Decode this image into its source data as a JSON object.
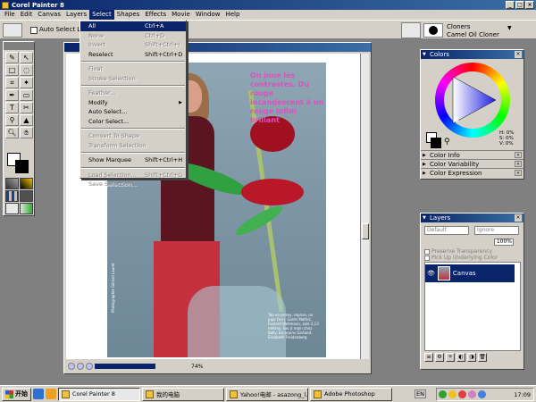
{
  "app": {
    "title": "Corel Painter 8"
  },
  "menubar": [
    "File",
    "Edit",
    "Canvas",
    "Layers",
    "Select",
    "Shapes",
    "Effects",
    "Movie",
    "Window",
    "Help"
  ],
  "active_menu": "Select",
  "propbar": {
    "auto_select_label": "Auto Select Layer",
    "brush_category": "Cloners",
    "brush_variant": "Camel Oil Cloner"
  },
  "select_menu": [
    {
      "label": "All",
      "shortcut": "Ctrl+A",
      "state": "highlight"
    },
    {
      "label": "None",
      "shortcut": "Ctrl+D",
      "state": "disabled"
    },
    {
      "label": "Invert",
      "shortcut": "Shift+Ctrl+I",
      "state": "disabled"
    },
    {
      "label": "Reselect",
      "shortcut": "Shift+Ctrl+D",
      "state": "enabled"
    },
    {
      "sep": true
    },
    {
      "label": "Float",
      "shortcut": "",
      "state": "disabled"
    },
    {
      "label": "Stroke Selection",
      "shortcut": "",
      "state": "disabled"
    },
    {
      "sep": true
    },
    {
      "label": "Feather...",
      "shortcut": "",
      "state": "disabled"
    },
    {
      "label": "Modify",
      "shortcut": "",
      "state": "enabled",
      "submenu": true
    },
    {
      "label": "Auto Select...",
      "shortcut": "",
      "state": "enabled"
    },
    {
      "label": "Color Select...",
      "shortcut": "",
      "state": "enabled"
    },
    {
      "sep": true
    },
    {
      "label": "Convert To Shape",
      "shortcut": "",
      "state": "disabled"
    },
    {
      "label": "Transform Selection",
      "shortcut": "",
      "state": "disabled"
    },
    {
      "sep": true
    },
    {
      "label": "Show Marquee",
      "shortcut": "Shift+Ctrl+H",
      "state": "enabled"
    },
    {
      "sep": true
    },
    {
      "label": "Load Selection...",
      "shortcut": "Shift+Ctrl+G",
      "state": "disabled"
    },
    {
      "label": "Save Selection...",
      "shortcut": "",
      "state": "disabled"
    }
  ],
  "document": {
    "headline": "On joue les contrastes. Du rouge incandescent à un rouge infini brillant",
    "caption": "Top en jersey, reprise, ou jupe Ferri. Gants Mathis. Foulard Wellmann, soie 2,13 mètres. Sac à main chez Bally. Escarpins Garland. Élisabeth Freidenberg.",
    "vertical_caption": "Photographie Gérard Lauret",
    "zoom": "74%"
  },
  "colors": {
    "title": "Colors",
    "hsv": {
      "h": "H: 0%",
      "s": "S: 0%",
      "v": "V: 0%"
    },
    "sub_palettes": [
      "Color Info",
      "Color Variability",
      "Color Expression"
    ]
  },
  "layers": {
    "title": "Layers",
    "composite_method": "Default",
    "composite_depth": "Ignore",
    "opacity": "100%",
    "preserve_transparency": "Preserve Transparency",
    "pick_up_color": "Pick Up Underlying Color",
    "items": [
      {
        "name": "Canvas"
      }
    ]
  },
  "taskbar": {
    "start": "开始",
    "tasks": [
      {
        "label": "Corel Painter 8",
        "active": true
      },
      {
        "label": "我的电脑",
        "active": false
      },
      {
        "label": "Yahoo!电邮 - asazong_l...",
        "active": false
      },
      {
        "label": "Adobe Photoshop",
        "active": false
      }
    ],
    "lang": "EN",
    "clock": "17:09"
  },
  "colors_map": {
    "title_bar": "#0a246a",
    "chrome": "#d4d0c8",
    "workspace": "#808080",
    "headline_pink": "#e050c0"
  }
}
